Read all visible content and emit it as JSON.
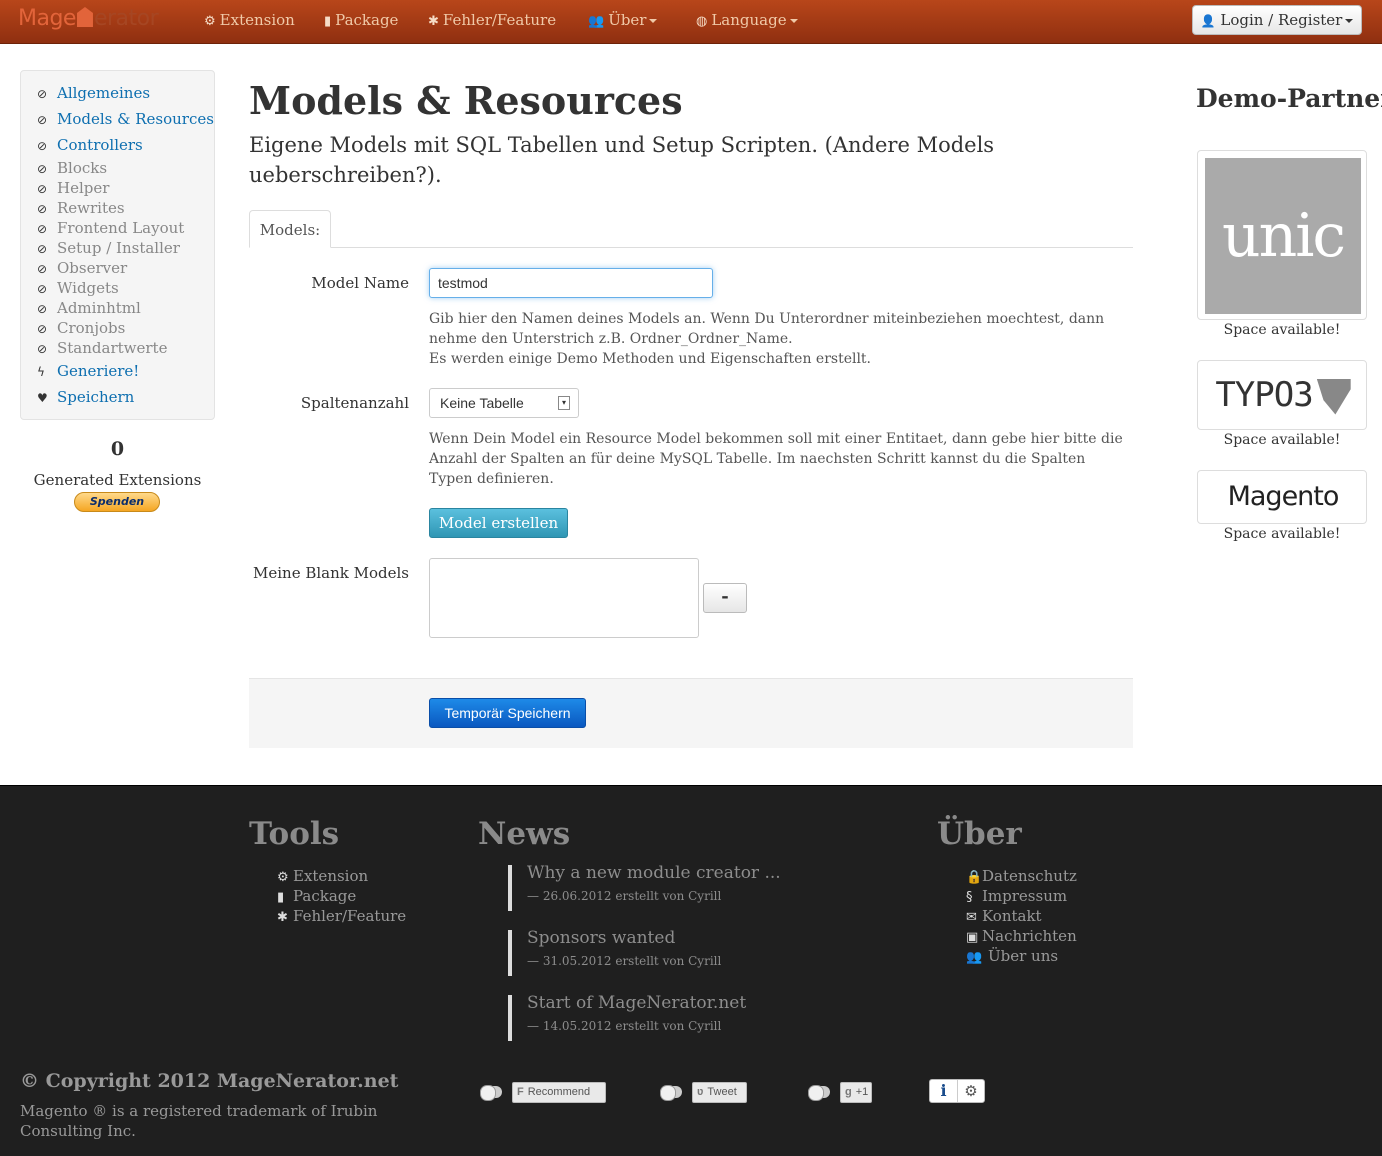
{
  "navbar": {
    "brand": {
      "part1": "Mage",
      "part2": "erator"
    },
    "items": [
      {
        "icon": "cogs-icon",
        "glyph": "⚙",
        "label": "Extension"
      },
      {
        "icon": "book-icon",
        "glyph": "▮",
        "label": "Package"
      },
      {
        "icon": "bug-icon",
        "glyph": "✱",
        "label": "Fehler/Feature"
      },
      {
        "icon": "users-icon",
        "glyph": "👥",
        "label": "Über"
      },
      {
        "icon": "globe-icon",
        "glyph": "◍",
        "label": "Language"
      }
    ],
    "login": {
      "icon": "user-icon",
      "glyph": "👤",
      "label": "Login / Register"
    }
  },
  "sidebar": {
    "items": [
      {
        "label": "Allgemeines",
        "state": "active",
        "icon": "check-circle-icon",
        "glyph": "⊘"
      },
      {
        "label": "Models & Resources",
        "state": "active",
        "icon": "check-circle-icon",
        "glyph": "⊘"
      },
      {
        "label": "Controllers",
        "state": "active",
        "icon": "check-circle-icon",
        "glyph": "⊘"
      },
      {
        "label": "Blocks",
        "state": "disabled",
        "icon": "ban-icon",
        "glyph": "⊘"
      },
      {
        "label": "Helper",
        "state": "disabled",
        "icon": "ban-icon",
        "glyph": "⊘"
      },
      {
        "label": "Rewrites",
        "state": "disabled",
        "icon": "ban-icon",
        "glyph": "⊘"
      },
      {
        "label": "Frontend Layout",
        "state": "disabled",
        "icon": "ban-icon",
        "glyph": "⊘"
      },
      {
        "label": "Setup / Installer",
        "state": "disabled",
        "icon": "ban-icon",
        "glyph": "⊘"
      },
      {
        "label": "Observer",
        "state": "disabled",
        "icon": "ban-icon",
        "glyph": "⊘"
      },
      {
        "label": "Widgets",
        "state": "disabled",
        "icon": "ban-icon",
        "glyph": "⊘"
      },
      {
        "label": "Adminhtml",
        "state": "disabled",
        "icon": "ban-icon",
        "glyph": "⊘"
      },
      {
        "label": "Cronjobs",
        "state": "disabled",
        "icon": "ban-icon",
        "glyph": "⊘"
      },
      {
        "label": "Standartwerte",
        "state": "disabled",
        "icon": "ban-icon",
        "glyph": "⊘"
      },
      {
        "label": "Generiere!",
        "state": "generate",
        "icon": "bolt-icon",
        "glyph": "ϟ"
      },
      {
        "label": "Speichern",
        "state": "generate",
        "icon": "heart-icon",
        "glyph": "♥"
      }
    ],
    "generated_count": "0",
    "generated_label": "Generated Extensions",
    "donate_label": "Spenden"
  },
  "main": {
    "title": "Models & Resources",
    "subtitle": "Eigene Models mit SQL Tabellen und Setup Scripten. (Andere Models ueberschreiben?).",
    "tab_label": "Models:",
    "model_name_label": "Model Name",
    "model_name_value": "testmod",
    "model_name_help_1": "Gib hier den Namen deines Models an. Wenn Du Unterordner miteinbeziehen moechtest, dann nehme den Unterstrich z.B. Ordner_Ordner_Name.",
    "model_name_help_2": "Es werden einige Demo Methoden und Eigenschaften erstellt.",
    "columns_label": "Spaltenanzahl",
    "columns_value": "Keine Tabelle",
    "columns_help": "Wenn Dein Model ein Resource Model bekommen soll mit einer Entitaet, dann gebe hier bitte die Anzahl der Spalten an für deine MySQL Tabelle. Im naechsten Schritt kannst du die Spalten Typen definieren.",
    "create_button": "Model erstellen",
    "blank_models_label": "Meine Blank Models",
    "remove_button": "-",
    "save_button": "Temporär Speichern"
  },
  "partners": {
    "title": "Demo-Partner",
    "items": [
      {
        "logo": "unic",
        "caption": "Space available!"
      },
      {
        "logo": "TYPO3",
        "caption": "Space available!"
      },
      {
        "logo": "Magento",
        "caption": "Space available!"
      }
    ]
  },
  "footer": {
    "tools_heading": "Tools",
    "tools": [
      {
        "icon": "cogs-icon",
        "glyph": "⚙",
        "label": "Extension"
      },
      {
        "icon": "book-icon",
        "glyph": "▮",
        "label": "Package"
      },
      {
        "icon": "bug-icon",
        "glyph": "✱",
        "label": "Fehler/Feature"
      }
    ],
    "news_heading": "News",
    "news": [
      {
        "title": "Why a new module creator ...",
        "meta": "— 26.06.2012 erstellt von Cyrill"
      },
      {
        "title": "Sponsors wanted",
        "meta": "— 31.05.2012 erstellt von Cyrill"
      },
      {
        "title": "Start of MageNerator.net",
        "meta": "— 14.05.2012 erstellt von Cyrill"
      }
    ],
    "about_heading": "Über",
    "about": [
      {
        "icon": "lock-icon",
        "glyph": "🔒",
        "label": "Datenschutz"
      },
      {
        "icon": "section-icon",
        "glyph": "§",
        "label": "Impressum"
      },
      {
        "icon": "envelope-icon",
        "glyph": "✉",
        "label": "Kontakt"
      },
      {
        "icon": "inbox-icon",
        "glyph": "▣",
        "label": "Nachrichten"
      },
      {
        "icon": "users-icon",
        "glyph": "👥",
        "label": "Über uns"
      }
    ],
    "copyright": "© Copyright 2012 MageNerator.net",
    "trademark": "Magento ® is a registered trademark of Irubin Consulting Inc.",
    "social": {
      "facebook": "Recommend",
      "twitter": "Tweet",
      "google": "+1",
      "info": "i",
      "settings": "⚙"
    }
  }
}
